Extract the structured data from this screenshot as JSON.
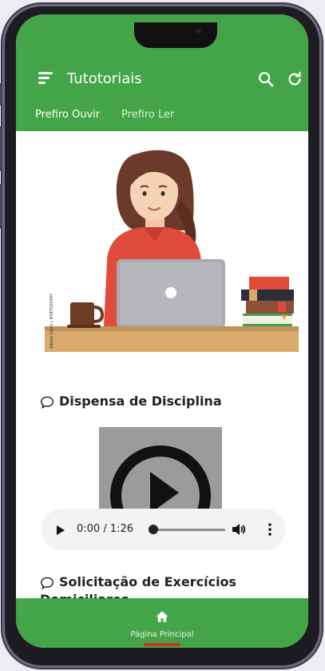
{
  "app": {
    "title": "Tutotoriais",
    "tabs": [
      {
        "label": "Prefiro Ouvir",
        "active": true
      },
      {
        "label": "Prefiro Ler",
        "active": false
      }
    ]
  },
  "colors": {
    "brand_green": "#43a548",
    "text_dark": "#222222",
    "player_bg": "#f1f3f4"
  },
  "icons": {
    "menu": "menu-icon",
    "search": "search-icon",
    "refresh": "refresh-icon",
    "chat": "chat-bubble-icon",
    "play": "play-icon",
    "volume": "volume-icon",
    "more": "more-vertical-icon",
    "home": "home-icon"
  },
  "illustration": {
    "watermark": "Adobe Stock | #587020397"
  },
  "sections": [
    {
      "title": "Dispensa de Disciplina"
    },
    {
      "title": "Solicitação de Exercícios",
      "title_cont": "Domiciliares"
    }
  ],
  "audio_player": {
    "time": "0:00 / 1:26",
    "progress": 0
  },
  "bottom_nav": {
    "home_label": "Página Principal"
  }
}
